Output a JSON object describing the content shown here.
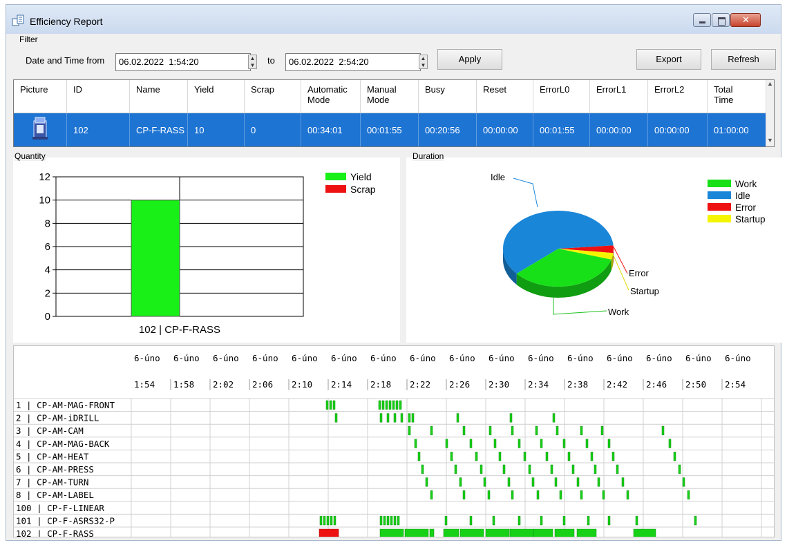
{
  "window": {
    "title": "Efficiency Report",
    "icons": [
      "app-report-icon",
      "minimize-icon",
      "maximize-icon",
      "close-icon"
    ]
  },
  "filter": {
    "group_label": "Filter",
    "from_label": "Date and Time from",
    "from_value": "06.02.2022  1:54:20",
    "to_label": "to",
    "to_value": "06.02.2022  2:54:20",
    "apply_label": "Apply",
    "export_label": "Export",
    "refresh_label": "Refresh"
  },
  "table": {
    "headers": [
      "Picture",
      "ID",
      "Name",
      "Yield",
      "Scrap",
      "Automatic\nMode",
      "Manual\nMode",
      "Busy",
      "Reset",
      "ErrorL0",
      "ErrorL1",
      "ErrorL2",
      "Total\nTime"
    ],
    "rows": [
      {
        "picture": "station-icon",
        "id": "102",
        "name": "CP-F-RASS",
        "yield": "10",
        "scrap": "0",
        "auto": "00:34:01",
        "manual": "00:01:55",
        "busy": "00:20:56",
        "reset": "00:00:00",
        "e0": "00:01:55",
        "e1": "00:00:00",
        "e2": "00:00:00",
        "total": "01:00:00"
      }
    ]
  },
  "quantity": {
    "group_label": "Quantity",
    "chart_data": {
      "type": "bar",
      "categories": [
        "102 | CP-F-RASS"
      ],
      "series": [
        {
          "name": "Yield",
          "values": [
            10
          ],
          "color": "#18f018"
        },
        {
          "name": "Scrap",
          "values": [
            0
          ],
          "color": "#ee1111"
        }
      ],
      "ylim": [
        0,
        12
      ],
      "yticks": [
        "0",
        "2",
        "4",
        "6",
        "8",
        "10",
        "12"
      ],
      "grid": true,
      "legend": "top-right"
    }
  },
  "duration": {
    "group_label": "Duration",
    "chart_data": {
      "type": "pie",
      "slices": [
        {
          "name": "Work",
          "value": 34.0,
          "color": "#18e018"
        },
        {
          "name": "Idle",
          "value": 60.0,
          "color": "#1a86d8"
        },
        {
          "name": "Error",
          "value": 3.2,
          "color": "#ee1111"
        },
        {
          "name": "Startup",
          "value": 2.8,
          "color": "#f5f500"
        }
      ],
      "legend": "top-right"
    }
  },
  "timeline": {
    "date_labels": [
      "6-úno",
      "6-úno",
      "6-úno",
      "6-úno",
      "6-úno",
      "6-úno",
      "6-úno",
      "6-úno",
      "6-úno",
      "6-úno",
      "6-úno",
      "6-úno",
      "6-úno",
      "6-úno",
      "6-úno",
      "6-úno"
    ],
    "time_labels": [
      "1:54",
      "1:58",
      "2:02",
      "2:06",
      "2:10",
      "2:14",
      "2:18",
      "2:22",
      "2:26",
      "2:30",
      "2:34",
      "2:38",
      "2:42",
      "2:46",
      "2:50",
      "2:54"
    ],
    "rows": [
      "1 | CP-AM-MAG-FRONT",
      "2 | CP-AM-iDRILL",
      "3 | CP-AM-CAM",
      "4 | CP-AM-MAG-BACK",
      "5 | CP-AM-HEAT",
      "6 | CP-AM-PRESS",
      "7 | CP-AM-TURN",
      "8 | CP-AM-LABEL",
      "100 | CP-F-LINEAR",
      "101 | CP-F-ASRS32-P",
      "102 | CP-F-RASS"
    ]
  }
}
